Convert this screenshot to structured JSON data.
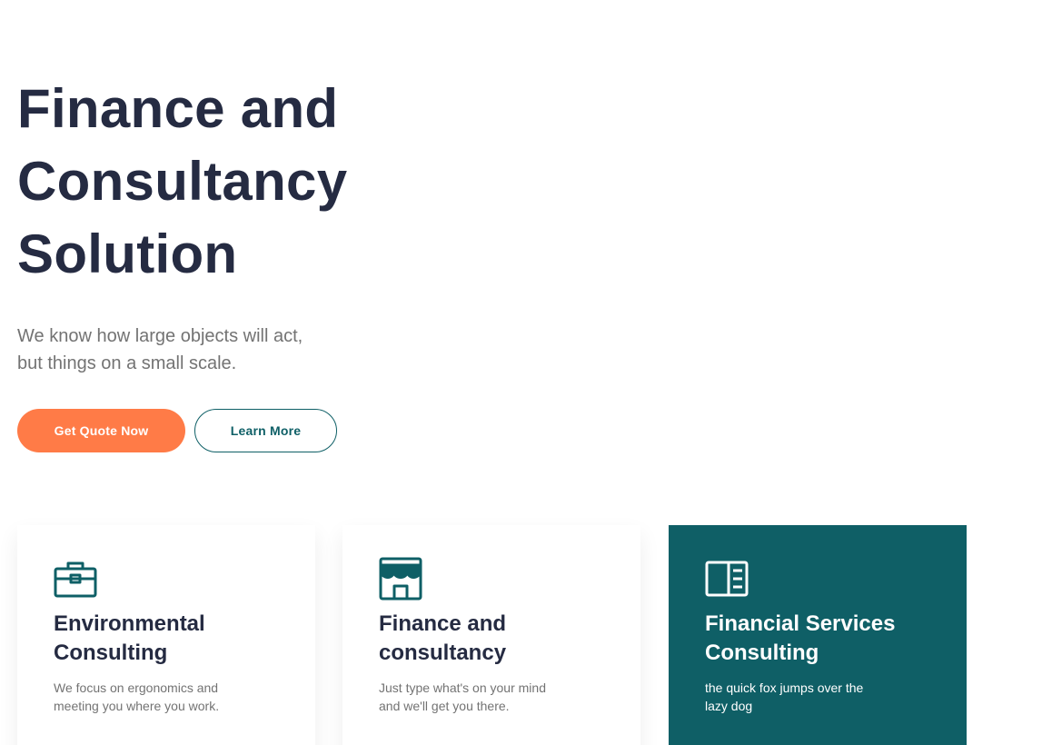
{
  "hero": {
    "title_lines": [
      "Finance and",
      "Consultancy",
      "Solution"
    ],
    "subtitle_lines": [
      "We know how large objects will act,",
      "but things on a small scale."
    ],
    "primary_button": "Get Quote Now",
    "secondary_button": "Learn More"
  },
  "colors": {
    "heading": "#252b42",
    "body_text": "#737373",
    "accent_orange": "#ff7b47",
    "teal": "#0e5f66"
  },
  "cards": [
    {
      "icon": "briefcase-icon",
      "title_lines": [
        "Environmental",
        "Consulting"
      ],
      "text_lines": [
        "We focus on ergonomics and",
        "meeting you where you work."
      ]
    },
    {
      "icon": "storefront-icon",
      "title_lines": [
        "Finance and",
        "consultancy"
      ],
      "text_lines": [
        "Just type what's on your mind",
        "and we'll get you there."
      ]
    },
    {
      "icon": "book-open-icon",
      "title_lines": [
        "Financial Services",
        "Consulting"
      ],
      "text_lines": [
        "the quick fox jumps over the",
        "lazy dog"
      ],
      "highlighted": true
    }
  ]
}
